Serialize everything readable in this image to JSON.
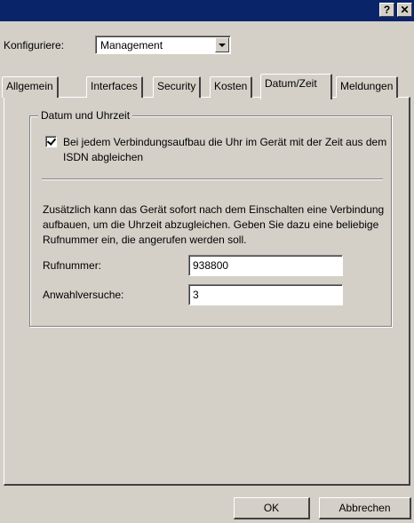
{
  "titlebar": {
    "help_label": "?",
    "close_label": "✕"
  },
  "config": {
    "label": "Konfiguriere:",
    "selected": "Management"
  },
  "tabs": [
    {
      "label": "Allgemein"
    },
    {
      "label": "Interfaces"
    },
    {
      "label": "Security"
    },
    {
      "label": "Kosten"
    },
    {
      "label": "Datum/Zeit",
      "active": true
    },
    {
      "label": "Meldungen"
    }
  ],
  "group": {
    "title": "Datum und Uhrzeit",
    "checkbox_label": "Bei jedem Verbindungsaufbau die Uhr im Gerät mit der Zeit aus dem ISDN abgleichen",
    "checkbox_checked": true,
    "description": "Zusätzlich kann das Gerät sofort nach dem Einschalten eine Verbindung aufbauen, um die Uhrzeit abzugleichen. Geben Sie dazu eine beliebige Rufnummer ein, die angerufen werden soll.",
    "rufnummer_label": "Rufnummer:",
    "rufnummer_value": "938800",
    "anwahl_label": "Anwahlversuche:",
    "anwahl_value": "3"
  },
  "buttons": {
    "ok": "OK",
    "cancel": "Abbrechen"
  },
  "colors": {
    "titlebar": "#0a246a",
    "face": "#d4d0c8"
  }
}
